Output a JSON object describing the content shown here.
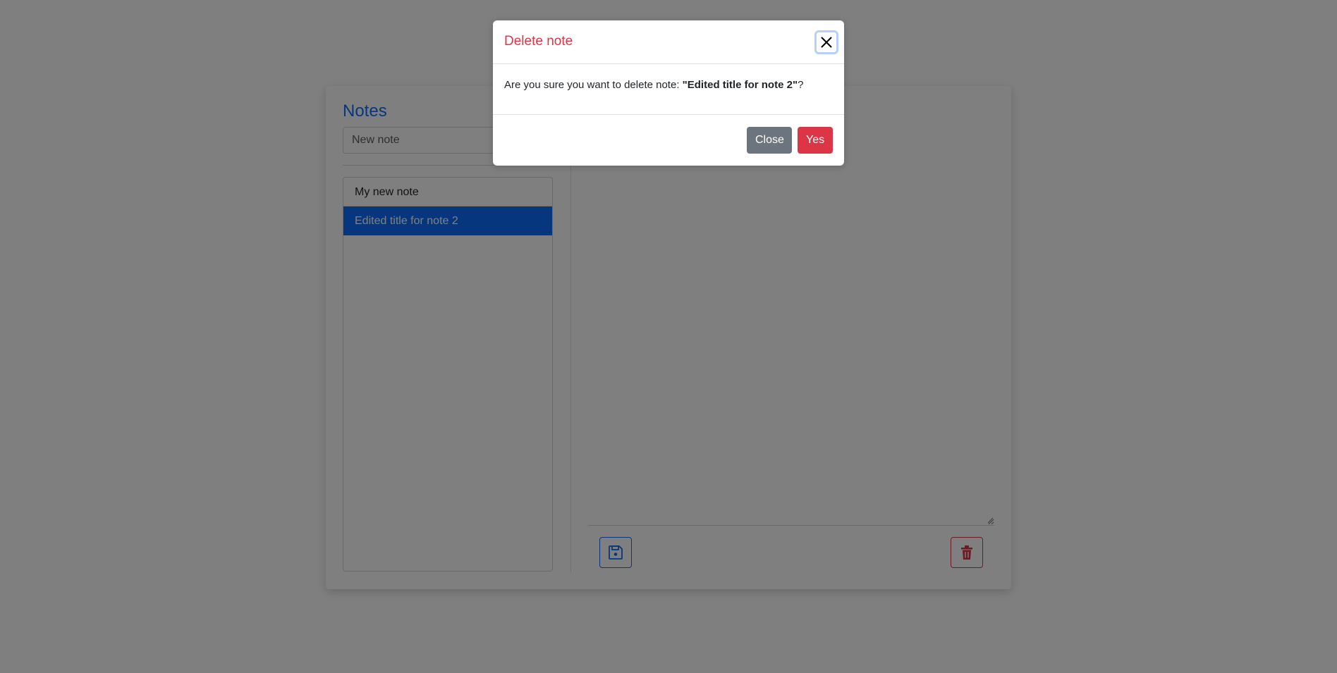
{
  "notes_panel": {
    "title": "Notes",
    "new_note_placeholder": "New note",
    "items": [
      {
        "label": "My new note"
      },
      {
        "label": "Edited title for note 2"
      }
    ]
  },
  "editor": {
    "save_icon": "floppy-disk-icon",
    "delete_icon": "trash-icon"
  },
  "modal": {
    "title": "Delete note",
    "close_icon": "close-x-icon",
    "message_prefix": "Are you sure you want to delete note: ",
    "note_name": "\"Edited title for note 2\"",
    "message_suffix": "?",
    "close_label": "Close",
    "yes_label": "Yes"
  },
  "colors": {
    "primary": "#0d6efd",
    "danger": "#dc3545",
    "secondary": "#6c757d"
  }
}
